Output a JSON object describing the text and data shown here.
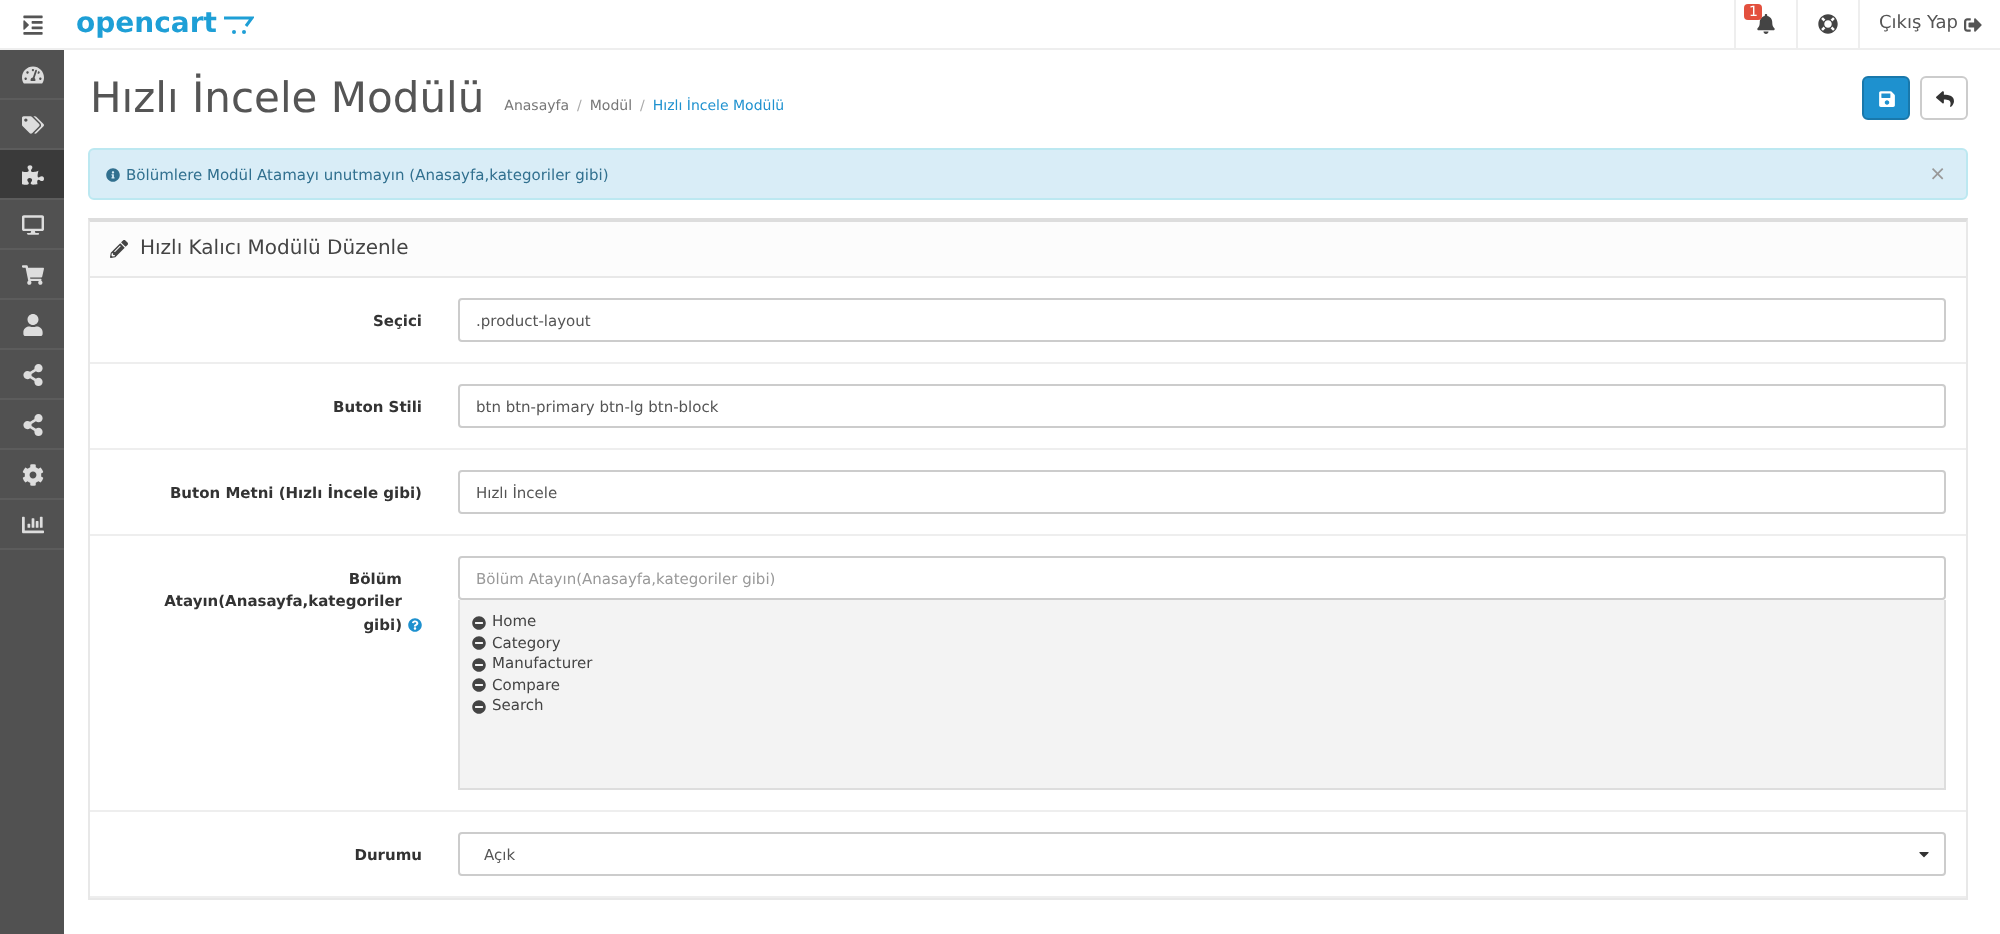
{
  "header": {
    "logo": "opencart",
    "notification_count": "1",
    "logout": "Çıkış Yap"
  },
  "sidebar": {
    "items": [
      {
        "selected": false
      },
      {
        "selected": false
      },
      {
        "selected": true
      },
      {
        "selected": false
      },
      {
        "selected": false
      },
      {
        "selected": false
      },
      {
        "selected": false
      },
      {
        "selected": false
      },
      {
        "selected": false
      },
      {
        "selected": false
      }
    ]
  },
  "page": {
    "title": "Hızlı İncele Modülü",
    "breadcrumbs": [
      {
        "label": "Anasayfa"
      },
      {
        "separator": "/",
        "label": "Modül"
      },
      {
        "separator": "/",
        "label": "Hızlı İncele Modülü"
      }
    ]
  },
  "alert": {
    "text": "Bölümlere Modül Atamayı unutmayın (Anasayfa,kategoriler gibi)",
    "close": "×"
  },
  "panel": {
    "title": "Hızlı Kalıcı Modülü Düzenle",
    "fields": [
      {
        "kind": "text",
        "label": "Seçici",
        "value": ".product-layout"
      },
      {
        "kind": "text",
        "label": "Buton Stili",
        "value": "btn btn-primary btn-lg btn-block"
      },
      {
        "kind": "text",
        "label": "Buton Metni (Hızlı İncele gibi)",
        "value": "Hızlı İncele"
      },
      {
        "kind": "multi",
        "label": "Bölüm Atayın(Anasayfa,kategoriler gibi)",
        "help": true,
        "placeholder": "Bölüm Atayın(Anasayfa,kategoriler gibi)",
        "items": [
          "Home",
          "Category",
          "Manufacturer",
          "Compare",
          "Search"
        ]
      },
      {
        "kind": "select",
        "label": "Durumu",
        "value": "Açık"
      }
    ]
  }
}
